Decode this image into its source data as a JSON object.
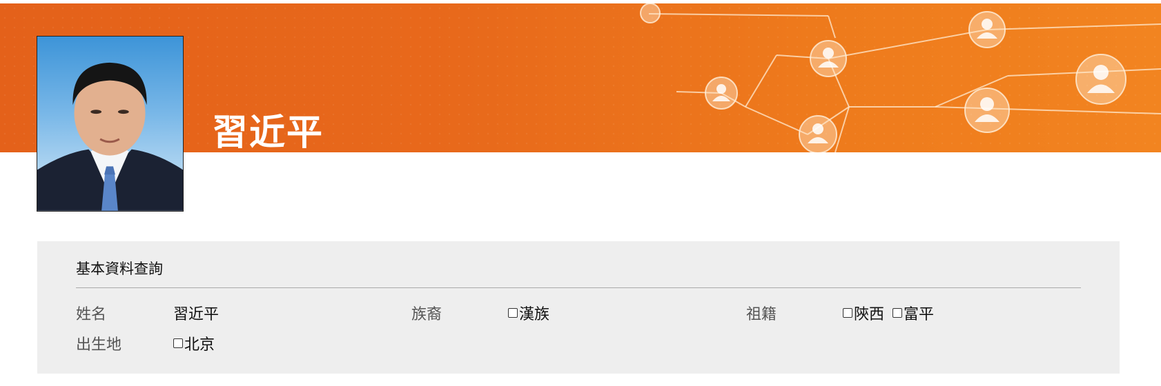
{
  "profile": {
    "name": "習近平"
  },
  "info_panel": {
    "title": "基本資料查詢",
    "fields": {
      "name": {
        "label": "姓名",
        "value": "習近平"
      },
      "ethnicity": {
        "label": "族裔",
        "options": [
          " 漢族"
        ]
      },
      "ancestry": {
        "label": "祖籍",
        "options": [
          "陝西",
          "富平"
        ]
      },
      "birthplace": {
        "label": "出生地",
        "options": [
          "北京"
        ]
      }
    }
  },
  "colors": {
    "banner": "#e8691b",
    "panel_bg": "#eeeeee",
    "heading_text": "#ffffff"
  }
}
